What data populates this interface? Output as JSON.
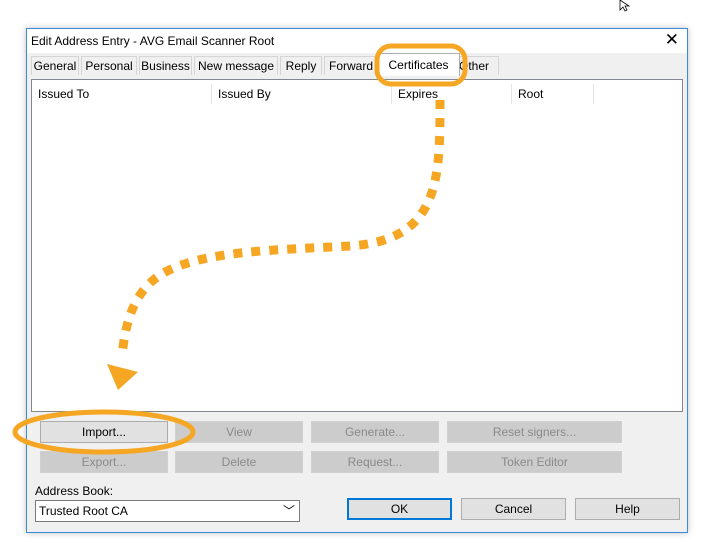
{
  "window": {
    "title": "Edit Address Entry - AVG Email Scanner Root",
    "close_glyph": "✕"
  },
  "tabs": [
    {
      "label": "General"
    },
    {
      "label": "Personal"
    },
    {
      "label": "Business"
    },
    {
      "label": "New message"
    },
    {
      "label": "Reply"
    },
    {
      "label": "Forward"
    },
    {
      "label": "Certificates",
      "selected": true
    },
    {
      "label": "Other"
    }
  ],
  "table": {
    "columns": [
      "Issued To",
      "Issued By",
      "Expires",
      "Root"
    ],
    "rows": []
  },
  "buttons": {
    "import": "Import...",
    "view": "View",
    "generate": "Generate...",
    "reset_signers": "Reset signers...",
    "export": "Export...",
    "delete": "Delete",
    "request": "Request...",
    "token_editor": "Token Editor",
    "ok": "OK",
    "cancel": "Cancel",
    "help": "Help"
  },
  "address_book": {
    "label": "Address Book:",
    "value": "Trusted Root CA",
    "chevron": "﹀"
  },
  "annotation": {
    "color": "#f5a623"
  }
}
